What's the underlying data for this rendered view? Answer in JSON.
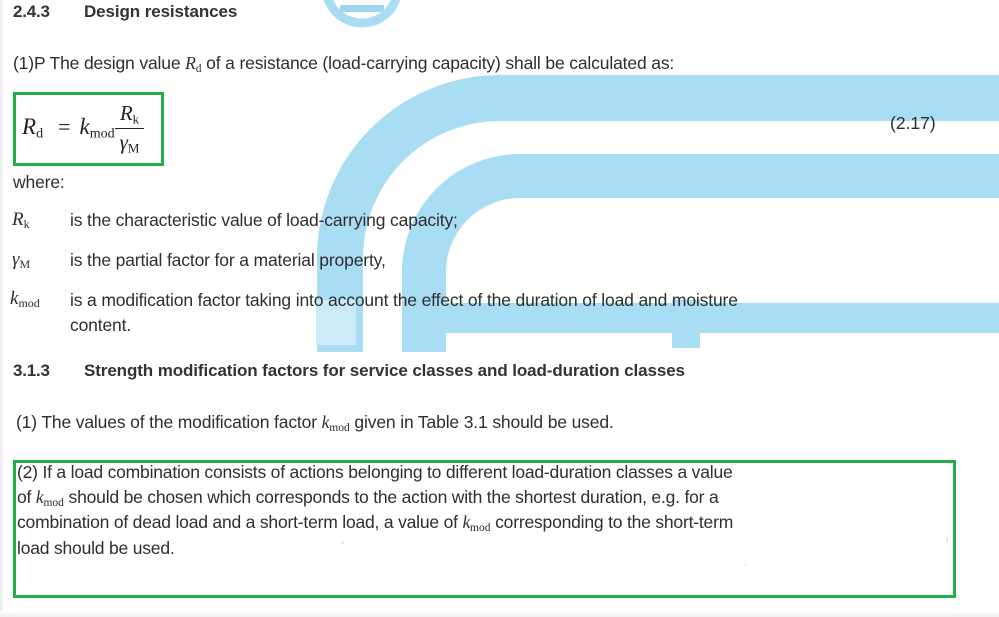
{
  "document": {
    "page_background": "#ffffff",
    "highlight_color": "#1fae4a",
    "watermark_color": "#a9ddf4"
  },
  "sections": [
    {
      "number": "2.4.3",
      "title": "Design resistances"
    },
    {
      "number": "3.1.3",
      "title": "Strength modification factors for service classes and load-duration classes"
    }
  ],
  "clause_1p": {
    "prefix": "(1)P The design value ",
    "symbol": "R",
    "symbol_sub": "d",
    "suffix": " of a resistance (load-carrying capacity) shall be calculated as:"
  },
  "equation": {
    "lhs": "R",
    "lhs_sub": "d",
    "equals": "=",
    "factor": "k",
    "factor_sub": "mod",
    "numerator": "R",
    "numerator_sub": "k",
    "denominator": "γ",
    "denominator_sub": "M",
    "number": "(2.17)",
    "boxed": true
  },
  "where_label": "where:",
  "definitions": [
    {
      "symbol": "R",
      "symbol_sub": "k",
      "text": "is the characteristic value of load-carrying capacity;"
    },
    {
      "symbol": "γ",
      "symbol_sub": "M",
      "text": "is the partial factor for a material property,"
    },
    {
      "symbol": "k",
      "symbol_sub": "mod",
      "text_line1": "is a modification factor taking into account the effect of the duration of load and moisture",
      "text_line2": "content."
    }
  ],
  "clause_3_1_3_1": {
    "prefix": "(1) The values of the modification factor ",
    "symbol": "k",
    "symbol_sub": "mod",
    "suffix": " given in Table 3.1 should be used."
  },
  "clause_3_1_3_2": {
    "boxed": true,
    "line1_a": "(2) If a load combination consists of actions belonging to different load-duration classes a value",
    "line2_a": "of ",
    "line2_sym": "k",
    "line2_sym_sub": "mod",
    "line2_b": " should be chosen which corresponds to the action with the shortest duration, e.g. for a",
    "line3_a": "combination of dead load and a short-term load, a value of ",
    "line3_sym": "k",
    "line3_sym_sub": "mod",
    "line3_b": " corresponding to the short-term",
    "line4_a": "load should be used."
  }
}
